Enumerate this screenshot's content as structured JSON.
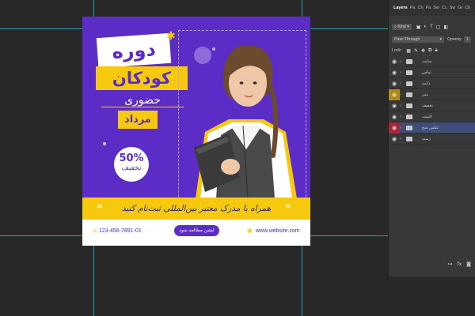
{
  "artboard": {
    "headline_1": "دوره",
    "headline_2": "کودکان",
    "headline_3": "حضوری",
    "headline_4": "مرداد",
    "discount_percent": "50%",
    "discount_label": "تخفیف",
    "banner_text": "همراه با مدرک معتبر بین‌المللی ثبت‌نام کنید",
    "phone": "123-456-7891-01",
    "cta_label": "ایشن مطالعه شود",
    "website": "www.website.com"
  },
  "layers_panel": {
    "tabs": [
      "Layers",
      "Pa",
      "Ch",
      "Pa",
      "Sw",
      "Cc",
      "Sw",
      "Gr",
      "Ck"
    ],
    "filter_kind": "Kind",
    "blend_mode": "Pass Through",
    "opacity_label": "Opacity:",
    "opacity_value": "1",
    "lock_label": "Lock:",
    "layers": [
      {
        "name": "سایت",
        "eye_color": "#434343",
        "selected": false
      },
      {
        "name": "تماس",
        "eye_color": "#434343",
        "selected": false
      },
      {
        "name": "دکمه",
        "eye_color": "#434343",
        "selected": false
      },
      {
        "name": "متن",
        "eye_color": "#b08d10",
        "selected": false
      },
      {
        "name": "تخفیف",
        "eye_color": "#434343",
        "selected": false
      },
      {
        "name": "المنت",
        "eye_color": "#434343",
        "selected": false
      },
      {
        "name": "عکس شخ",
        "eye_color": "#a8253a",
        "selected": true
      },
      {
        "name": "زمینه",
        "eye_color": "#434343",
        "selected": false
      }
    ],
    "footer_icons": [
      "link-icon",
      "fx-icon",
      "mask-icon"
    ]
  },
  "colors": {
    "accent_purple": "#5b2dc6",
    "accent_yellow": "#f7c90e"
  }
}
